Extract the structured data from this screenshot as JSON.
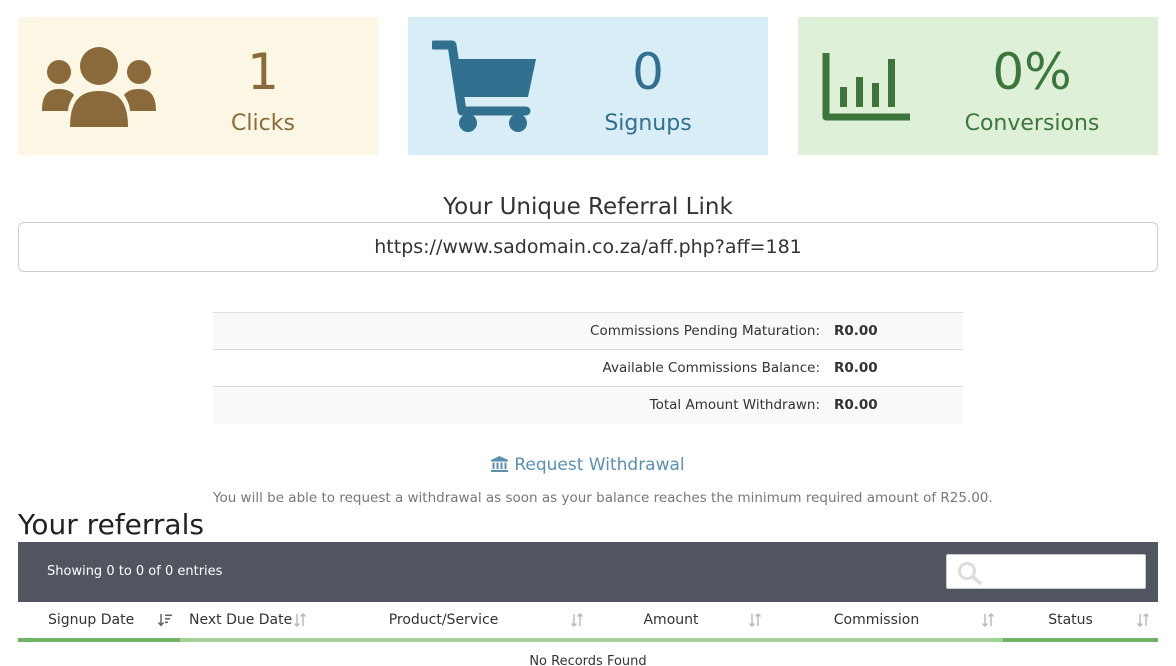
{
  "stats": {
    "clicks": {
      "value": "1",
      "label": "Clicks",
      "icon": "users-icon",
      "color": "#8a6a3b",
      "bg": "#fcf7e4"
    },
    "signups": {
      "value": "0",
      "label": "Signups",
      "icon": "shopping-cart-icon",
      "color": "#31708f",
      "bg": "#d9edf7"
    },
    "conversions": {
      "value": "0%",
      "label": "Conversions",
      "icon": "bar-chart-icon",
      "color": "#3c763d",
      "bg": "#dff0d8"
    }
  },
  "referral": {
    "heading": "Your Unique Referral Link",
    "link": "https://www.sadomain.co.za/aff.php?aff=181"
  },
  "commissions": [
    {
      "label": "Commissions Pending Maturation:",
      "amount": "R0.00"
    },
    {
      "label": "Available Commissions Balance:",
      "amount": "R0.00"
    },
    {
      "label": "Total Amount Withdrawn:",
      "amount": "R0.00"
    }
  ],
  "withdrawal": {
    "link_label": "Request Withdrawal",
    "note": "You will be able to request a withdrawal as soon as your balance reaches the minimum required amount of R25.00."
  },
  "referrals": {
    "title": "Your referrals",
    "info": "Showing 0 to 0 of 0 entries",
    "search_placeholder": "",
    "columns": [
      "Signup Date",
      "Next Due Date",
      "Product/Service",
      "Amount",
      "Commission",
      "Status"
    ],
    "empty_message": "No Records Found"
  },
  "colors": {
    "toolbar_bg": "#505560",
    "link": "#5b8fb0",
    "header_underline": "#a5d29a",
    "header_underline_active": "#6fb463"
  }
}
